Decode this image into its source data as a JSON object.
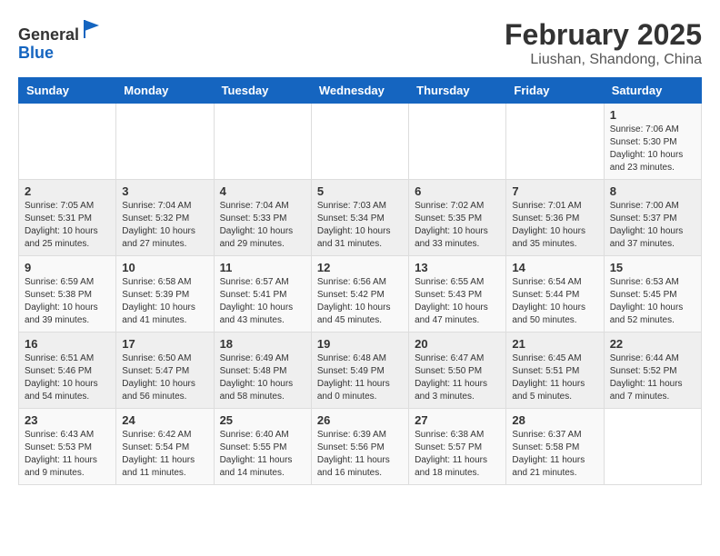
{
  "header": {
    "logo_line1": "General",
    "logo_line2": "Blue",
    "main_title": "February 2025",
    "subtitle": "Liushan, Shandong, China"
  },
  "calendar": {
    "days_of_week": [
      "Sunday",
      "Monday",
      "Tuesday",
      "Wednesday",
      "Thursday",
      "Friday",
      "Saturday"
    ],
    "weeks": [
      [
        {
          "day": "",
          "info": ""
        },
        {
          "day": "",
          "info": ""
        },
        {
          "day": "",
          "info": ""
        },
        {
          "day": "",
          "info": ""
        },
        {
          "day": "",
          "info": ""
        },
        {
          "day": "",
          "info": ""
        },
        {
          "day": "1",
          "info": "Sunrise: 7:06 AM\nSunset: 5:30 PM\nDaylight: 10 hours and 23 minutes."
        }
      ],
      [
        {
          "day": "2",
          "info": "Sunrise: 7:05 AM\nSunset: 5:31 PM\nDaylight: 10 hours and 25 minutes."
        },
        {
          "day": "3",
          "info": "Sunrise: 7:04 AM\nSunset: 5:32 PM\nDaylight: 10 hours and 27 minutes."
        },
        {
          "day": "4",
          "info": "Sunrise: 7:04 AM\nSunset: 5:33 PM\nDaylight: 10 hours and 29 minutes."
        },
        {
          "day": "5",
          "info": "Sunrise: 7:03 AM\nSunset: 5:34 PM\nDaylight: 10 hours and 31 minutes."
        },
        {
          "day": "6",
          "info": "Sunrise: 7:02 AM\nSunset: 5:35 PM\nDaylight: 10 hours and 33 minutes."
        },
        {
          "day": "7",
          "info": "Sunrise: 7:01 AM\nSunset: 5:36 PM\nDaylight: 10 hours and 35 minutes."
        },
        {
          "day": "8",
          "info": "Sunrise: 7:00 AM\nSunset: 5:37 PM\nDaylight: 10 hours and 37 minutes."
        }
      ],
      [
        {
          "day": "9",
          "info": "Sunrise: 6:59 AM\nSunset: 5:38 PM\nDaylight: 10 hours and 39 minutes."
        },
        {
          "day": "10",
          "info": "Sunrise: 6:58 AM\nSunset: 5:39 PM\nDaylight: 10 hours and 41 minutes."
        },
        {
          "day": "11",
          "info": "Sunrise: 6:57 AM\nSunset: 5:41 PM\nDaylight: 10 hours and 43 minutes."
        },
        {
          "day": "12",
          "info": "Sunrise: 6:56 AM\nSunset: 5:42 PM\nDaylight: 10 hours and 45 minutes."
        },
        {
          "day": "13",
          "info": "Sunrise: 6:55 AM\nSunset: 5:43 PM\nDaylight: 10 hours and 47 minutes."
        },
        {
          "day": "14",
          "info": "Sunrise: 6:54 AM\nSunset: 5:44 PM\nDaylight: 10 hours and 50 minutes."
        },
        {
          "day": "15",
          "info": "Sunrise: 6:53 AM\nSunset: 5:45 PM\nDaylight: 10 hours and 52 minutes."
        }
      ],
      [
        {
          "day": "16",
          "info": "Sunrise: 6:51 AM\nSunset: 5:46 PM\nDaylight: 10 hours and 54 minutes."
        },
        {
          "day": "17",
          "info": "Sunrise: 6:50 AM\nSunset: 5:47 PM\nDaylight: 10 hours and 56 minutes."
        },
        {
          "day": "18",
          "info": "Sunrise: 6:49 AM\nSunset: 5:48 PM\nDaylight: 10 hours and 58 minutes."
        },
        {
          "day": "19",
          "info": "Sunrise: 6:48 AM\nSunset: 5:49 PM\nDaylight: 11 hours and 0 minutes."
        },
        {
          "day": "20",
          "info": "Sunrise: 6:47 AM\nSunset: 5:50 PM\nDaylight: 11 hours and 3 minutes."
        },
        {
          "day": "21",
          "info": "Sunrise: 6:45 AM\nSunset: 5:51 PM\nDaylight: 11 hours and 5 minutes."
        },
        {
          "day": "22",
          "info": "Sunrise: 6:44 AM\nSunset: 5:52 PM\nDaylight: 11 hours and 7 minutes."
        }
      ],
      [
        {
          "day": "23",
          "info": "Sunrise: 6:43 AM\nSunset: 5:53 PM\nDaylight: 11 hours and 9 minutes."
        },
        {
          "day": "24",
          "info": "Sunrise: 6:42 AM\nSunset: 5:54 PM\nDaylight: 11 hours and 11 minutes."
        },
        {
          "day": "25",
          "info": "Sunrise: 6:40 AM\nSunset: 5:55 PM\nDaylight: 11 hours and 14 minutes."
        },
        {
          "day": "26",
          "info": "Sunrise: 6:39 AM\nSunset: 5:56 PM\nDaylight: 11 hours and 16 minutes."
        },
        {
          "day": "27",
          "info": "Sunrise: 6:38 AM\nSunset: 5:57 PM\nDaylight: 11 hours and 18 minutes."
        },
        {
          "day": "28",
          "info": "Sunrise: 6:37 AM\nSunset: 5:58 PM\nDaylight: 11 hours and 21 minutes."
        },
        {
          "day": "",
          "info": ""
        }
      ]
    ]
  }
}
